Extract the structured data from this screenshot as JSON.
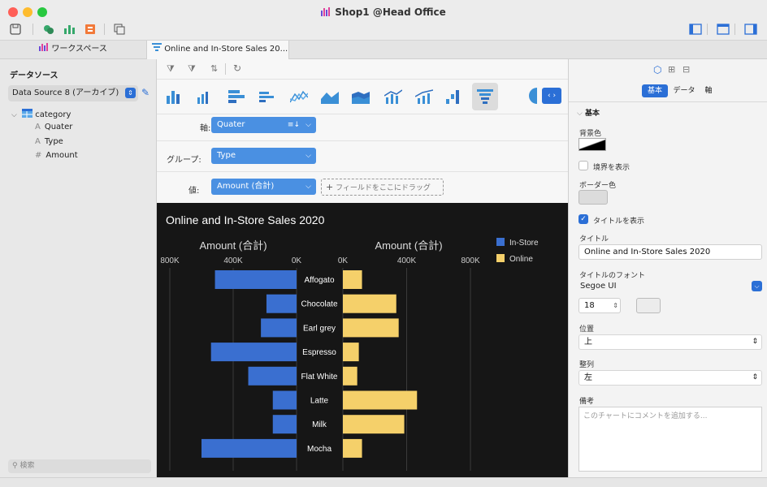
{
  "window": {
    "title": "Shop1 @Head Office"
  },
  "tabs": [
    {
      "label": "ワークスペース"
    },
    {
      "label": "Online and In-Store Sales 20..."
    }
  ],
  "sidebar": {
    "heading": "データソース",
    "datasource": "Data Source 8 (アーカイブ)",
    "tree": {
      "root": "category",
      "fields": [
        {
          "label": "Quater",
          "glyph": "A"
        },
        {
          "label": "Type",
          "glyph": "A"
        },
        {
          "label": "Amount",
          "glyph": "#"
        }
      ]
    },
    "search_placeholder": "検索"
  },
  "shelves": {
    "axis": {
      "label": "軸:",
      "value": "Quater"
    },
    "group": {
      "label": "グループ:",
      "value": "Type"
    },
    "values": {
      "label": "値:",
      "value": "Amount (合計)",
      "drop_hint": "フィールドをここにドラッグ"
    }
  },
  "chart_data": {
    "type": "bar",
    "title": "Online and In-Store Sales 2020",
    "orientation": "horizontal-butterfly",
    "categories": [
      "Affogato",
      "Chocolate",
      "Earl grey",
      "Espresso",
      "Flat White",
      "Latte",
      "Milk",
      "Mocha"
    ],
    "series": [
      {
        "name": "In-Store",
        "color": "#3a6fd0",
        "values": [
          515000,
          190000,
          225000,
          540000,
          305000,
          150000,
          150000,
          600000
        ]
      },
      {
        "name": "Online",
        "color": "#f5d06a",
        "values": [
          120000,
          335000,
          350000,
          100000,
          90000,
          465000,
          385000,
          120000
        ]
      }
    ],
    "left_axis": {
      "label": "Amount (合計)",
      "ticks": [
        "800K",
        "400K",
        "0K"
      ],
      "range": [
        0,
        800000
      ]
    },
    "right_axis": {
      "label": "Amount (合計)",
      "ticks": [
        "0K",
        "400K",
        "800K"
      ],
      "range": [
        0,
        800000
      ]
    },
    "legend_position": "top-right",
    "grid": true
  },
  "right_panel": {
    "tabs": [
      "基本",
      "データ",
      "軸"
    ],
    "section": "基本",
    "bg_color_label": "背景色",
    "show_border_label": "境界を表示",
    "border_color_label": "ボーダー色",
    "show_title_label": "タイトルを表示",
    "title_label": "タイトル",
    "title_value": "Online and In-Store Sales 2020",
    "title_font_label": "タイトルのフォント",
    "title_font_value": "Segoe UI",
    "font_size": "18",
    "position_label": "位置",
    "position_value": "上",
    "align_label": "整列",
    "align_value": "左",
    "notes_label": "備考",
    "notes_placeholder": "このチャートにコメントを追加する..."
  },
  "colors": {
    "accent": "#4a90e2",
    "chart_bg": "#161616",
    "instore": "#3a6fd0",
    "online": "#f5d06a"
  }
}
